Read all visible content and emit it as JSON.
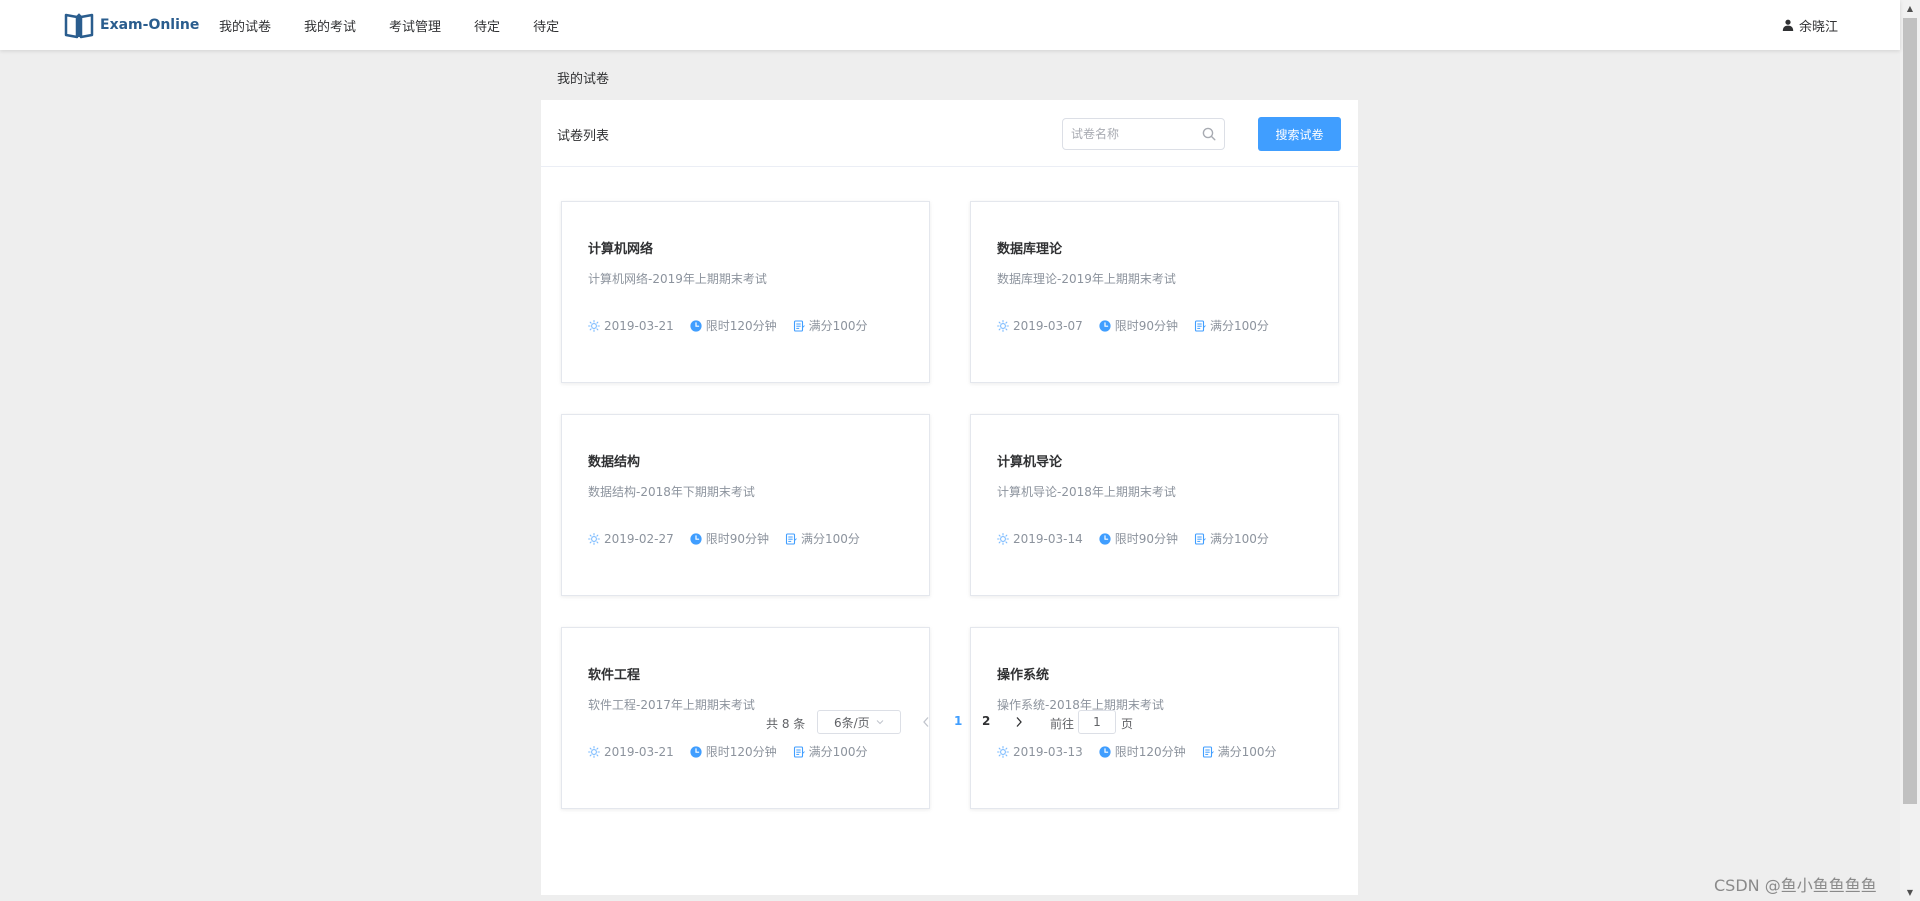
{
  "app": {
    "name": "Exam-Online"
  },
  "nav": {
    "items": [
      {
        "label": "我的试卷"
      },
      {
        "label": "我的考试"
      },
      {
        "label": "考试管理"
      },
      {
        "label": "待定"
      },
      {
        "label": "待定"
      }
    ]
  },
  "user": {
    "name": "余晓江"
  },
  "breadcrumb": {
    "current": "我的试卷"
  },
  "panel": {
    "title": "试卷列表",
    "search_placeholder": "试卷名称",
    "search_button": "搜索试卷"
  },
  "papers": [
    {
      "title": "计算机网络",
      "desc": "计算机网络-2019年上期期末考试",
      "date": "2019-03-21",
      "time_limit": "限时120分钟",
      "score": "满分100分"
    },
    {
      "title": "数据库理论",
      "desc": "数据库理论-2019年上期期末考试",
      "date": "2019-03-07",
      "time_limit": "限时90分钟",
      "score": "满分100分"
    },
    {
      "title": "数据结构",
      "desc": "数据结构-2018年下期期末考试",
      "date": "2019-02-27",
      "time_limit": "限时90分钟",
      "score": "满分100分"
    },
    {
      "title": "计算机导论",
      "desc": "计算机导论-2018年上期期末考试",
      "date": "2019-03-14",
      "time_limit": "限时90分钟",
      "score": "满分100分"
    },
    {
      "title": "软件工程",
      "desc": "软件工程-2017年上期期末考试",
      "date": "2019-03-21",
      "time_limit": "限时120分钟",
      "score": "满分100分"
    },
    {
      "title": "操作系统",
      "desc": "操作系统-2018年上期期末考试",
      "date": "2019-03-13",
      "time_limit": "限时120分钟",
      "score": "满分100分"
    }
  ],
  "pagination": {
    "total": "共 8 条",
    "page_size": "6条/页",
    "pages": [
      "1",
      "2"
    ],
    "current_page": "1",
    "goto_label": "前往",
    "goto_value": "1",
    "page_suffix": "页"
  },
  "watermark": "CSDN @鱼小鱼鱼鱼鱼",
  "colors": {
    "accent": "#409eff",
    "logo": "#2a5d8e",
    "muted_text": "#8c939d",
    "background": "#eeeeee"
  },
  "icons": {
    "logo": "open-book-icon",
    "user": "user-icon",
    "search": "search-icon",
    "date": "sun-icon",
    "time": "clock-icon",
    "score": "document-icon"
  }
}
